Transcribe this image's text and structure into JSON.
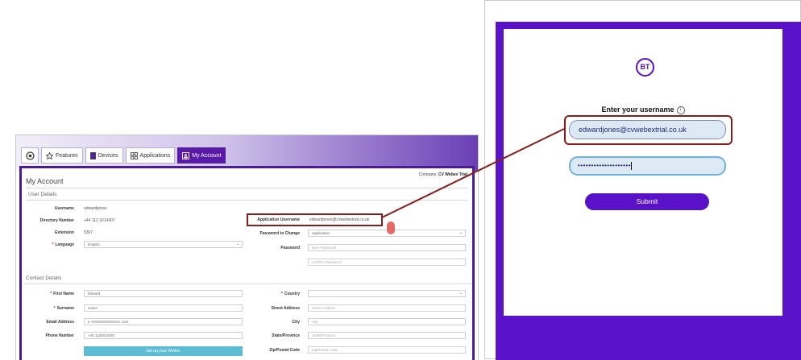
{
  "account_window": {
    "tabs": [
      {
        "label": "",
        "icon": "home-icon"
      },
      {
        "label": "Features",
        "icon": "star-icon"
      },
      {
        "label": "Devices",
        "icon": "phone-icon"
      },
      {
        "label": "Applications",
        "icon": "grid-icon"
      },
      {
        "label": "My Account",
        "icon": "account-icon"
      }
    ],
    "page_title": "My Account",
    "company_label": "Company:",
    "company_value": "CV Webex Trial",
    "user_details": {
      "section_title": "User Details",
      "username_label": "Username",
      "username_value": "edwardjones",
      "directory_number_label": "Directory Number",
      "directory_number_value": "+44 112 3214307",
      "extension_label": "Extension",
      "extension_value": "5307",
      "language_label": "Language",
      "language_value": "English",
      "application_username_label": "Application Username",
      "application_username_value": "edwardjones@cvwebextrial.co.uk",
      "password_to_change_label": "Password to Change",
      "password_to_change_value": "Application",
      "password_label": "Password",
      "new_password_placeholder": "New Password",
      "confirm_password_placeholder": "Confirm Password"
    },
    "contact_details": {
      "section_title": "Contact Details",
      "first_name_label": "First Name",
      "first_name_value": "Edward",
      "surname_label": "Surname",
      "surname_value": "Jones",
      "email_label": "Email Address",
      "email_prefix": "e",
      "email_suffix": ".com",
      "phone_label": "Phone Number",
      "phone_value": "+44 1120314307",
      "country_label": "Country",
      "country_value": "",
      "street_label": "Street Address",
      "street_placeholder": "Street Address",
      "city_label": "City",
      "city_placeholder": "City",
      "state_label": "State/Province",
      "state_placeholder": "State/Province",
      "zip_label": "Zip/Postal Code",
      "zip_placeholder": "Zip/Postal Code",
      "webex_button": "Set up your Webex"
    }
  },
  "login_window": {
    "logo_text": "BT",
    "enter_username_label": "Enter your username",
    "username_value": "edwardjones@cvwebextrial.co.uk",
    "password_mask": "••••••••••••••••••••",
    "submit_label": "Submit",
    "colors": {
      "brand_purple": "#5a12c9",
      "highlight_red": "#8a1c1c"
    }
  }
}
